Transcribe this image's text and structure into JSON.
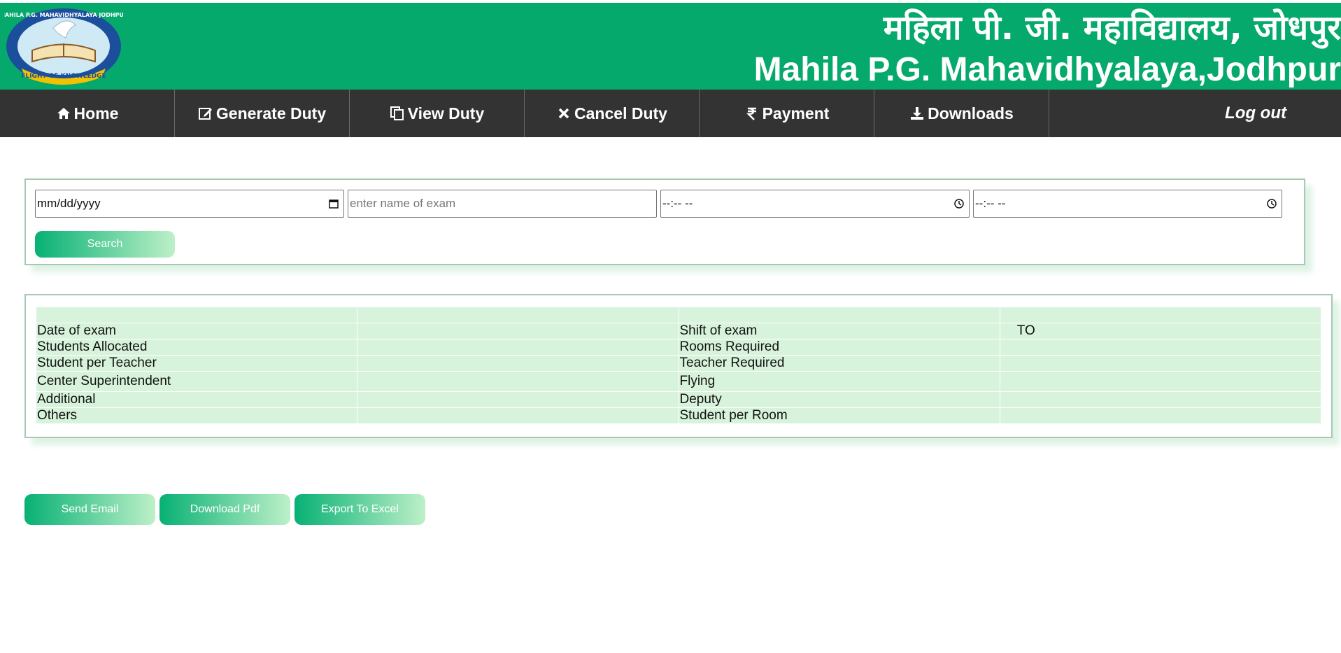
{
  "header": {
    "logo": {
      "ring_text": "MAHILA P.G. MAHAVIDHYALAYA JODHPUR",
      "motto": "FLIGHT OF KNOWLEDGE"
    },
    "title_hindi": "महिला पी. जी. महाविद्यालय, जोधपुर",
    "title_english": "Mahila P.G. Mahavidhyalaya,Jodhpur",
    "color": "#05a96b"
  },
  "nav": {
    "items": [
      {
        "label": "Home",
        "icon": "home-icon"
      },
      {
        "label": "Generate Duty",
        "icon": "edit-icon"
      },
      {
        "label": "View Duty",
        "icon": "copy-icon"
      },
      {
        "label": "Cancel Duty",
        "icon": "close-icon"
      },
      {
        "label": "Payment",
        "icon": "rupee-icon"
      },
      {
        "label": "Downloads",
        "icon": "download-icon"
      }
    ],
    "logout": "Log out",
    "color": "#333333"
  },
  "search": {
    "date_value": "mm/dd/yyyy",
    "exam_placeholder": "enter name of exam",
    "time_from_value": "--:-- --",
    "time_to_value": "--:-- --",
    "button": "Search"
  },
  "result": {
    "rows": [
      [
        "",
        "",
        "",
        ""
      ],
      [
        "Date of exam",
        "",
        "Shift of exam",
        "TO"
      ],
      [
        "Students Allocated",
        "",
        "Rooms Required",
        ""
      ],
      [
        "Student per Teacher",
        "",
        "Teacher Required",
        ""
      ],
      [
        "Center Superintendent",
        "",
        "Flying",
        ""
      ],
      [
        "Additional",
        "",
        "Deputy",
        ""
      ],
      [
        "Others",
        "",
        "Student per Room",
        ""
      ]
    ]
  },
  "actions": {
    "send_email": "Send Email",
    "download_pdf": "Download Pdf",
    "export_excel": "Export To Excel"
  }
}
